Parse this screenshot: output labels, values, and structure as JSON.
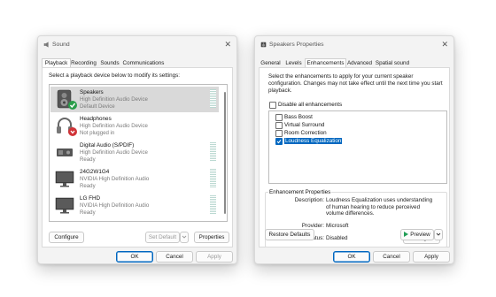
{
  "sound": {
    "title": "Sound",
    "close": "✕",
    "tabs": [
      "Playback",
      "Recording",
      "Sounds",
      "Communications"
    ],
    "instruction": "Select a playback device below to modify its settings:",
    "devices": [
      {
        "name": "Speakers",
        "line1": "High Definition Audio Device",
        "line2": "Default Device",
        "icon": "speaker-icon"
      },
      {
        "name": "Headphones",
        "line1": "High Definition Audio Device",
        "line2": "Not plugged in",
        "icon": "headphones-icon"
      },
      {
        "name": "Digital Audio (S/PDIF)",
        "line1": "High Definition Audio Device",
        "line2": "Ready",
        "icon": "digital-audio-icon"
      },
      {
        "name": "24G2W1G4",
        "line1": "NVIDIA High Definition Audio",
        "line2": "Ready",
        "icon": "monitor-icon"
      },
      {
        "name": "LG FHD",
        "line1": "NVIDIA High Definition Audio",
        "line2": "Ready",
        "icon": "monitor-icon"
      }
    ],
    "configure": "Configure",
    "set_default": "Set Default",
    "properties": "Properties",
    "ok": "OK",
    "cancel": "Cancel",
    "apply": "Apply"
  },
  "props": {
    "title": "Speakers Properties",
    "close": "✕",
    "tabs": [
      "General",
      "Levels",
      "Enhancements",
      "Advanced",
      "Spatial sound"
    ],
    "instruction": "Select the enhancements to apply for your current speaker configuration. Changes may not take effect until the next time you start playback.",
    "disable_all": "Disable all enhancements",
    "enhancements": [
      {
        "label": "Bass Boost",
        "checked": false
      },
      {
        "label": "Virtual Surround",
        "checked": false
      },
      {
        "label": "Room Correction",
        "checked": false
      },
      {
        "label": "Loudness Equalization",
        "checked": true
      }
    ],
    "group_title": "Enhancement Properties",
    "description_label": "Description:",
    "description": "Loudness Equalization uses understanding of human hearing to reduce perceived volume differences.",
    "provider_label": "Provider:",
    "provider": "Microsoft",
    "status_label": "Status:",
    "status": "Disabled",
    "settings": "Settings...",
    "restore": "Restore Defaults",
    "preview": "Preview",
    "ok": "OK",
    "cancel": "Cancel",
    "apply": "Apply"
  },
  "colors": {
    "accent": "#0067c0",
    "selected_row": "#d9d9d9",
    "level_meter": "#bcd9d2",
    "play_green": "#1f9d55"
  }
}
